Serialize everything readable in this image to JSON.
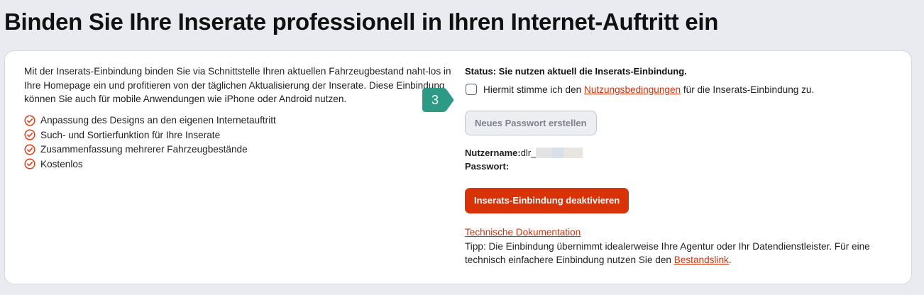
{
  "page": {
    "title": "Binden Sie Ihre Inserate professionell in Ihren Internet-Auftritt ein"
  },
  "intro": {
    "text": "Mit der Inserats-Einbindung binden Sie via Schnittstelle Ihren aktuellen Fahrzeugbestand naht-los in Ihre Homepage ein und profitieren von der täglichen Aktualisierung der Inserate. Diese Einbindung können Sie auch für mobile Anwendungen wie iPhone oder Android nutzen."
  },
  "features": [
    "Anpassung des Designs an den eigenen Internetauftritt",
    "Such- und Sortierfunktion für Ihre Inserate",
    "Zusammenfassung mehrerer Fahrzeugbestände",
    "Kostenlos"
  ],
  "status": {
    "text": "Status: Sie nutzen aktuell die Inserats-Einbindung."
  },
  "consent": {
    "prefix": "Hiermit stimme ich den ",
    "link": "Nutzungsbedingungen",
    "suffix": " für die Inserats-Einbindung zu.",
    "checked": false
  },
  "buttons": {
    "new_password": "Neues Passwort erstellen",
    "deactivate": "Inserats-Einbindung deaktivieren"
  },
  "credentials": {
    "username_label": "Nutzername:",
    "username_value": "dlr_",
    "password_label": "Passwort:"
  },
  "tech": {
    "doc_link": "Technische Dokumentation",
    "tip_text": "Tipp: Die Einbindung übernimmt idealerweise Ihre Agentur oder Ihr Datendienstleister. Für eine technisch einfachere Einbindung nutzen Sie den ",
    "stock_link": "Bestandslink",
    "tip_end": "."
  },
  "step_badge": {
    "number": "3",
    "color": "#2c9a84"
  },
  "colors": {
    "accent": "#d93206",
    "link": "#d0310e",
    "check": "#e0401a"
  }
}
